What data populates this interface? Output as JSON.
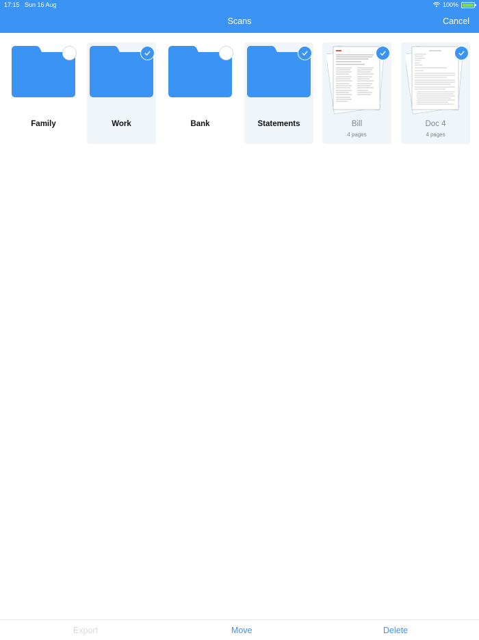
{
  "status_bar": {
    "time": "17:15",
    "date": "Sun 16 Aug",
    "battery": "100%"
  },
  "header": {
    "title": "Scans",
    "cancel_label": "Cancel"
  },
  "items": [
    {
      "kind": "folder",
      "label": "Family",
      "selected": false
    },
    {
      "kind": "folder",
      "label": "Work",
      "selected": true
    },
    {
      "kind": "folder",
      "label": "Bank",
      "selected": false
    },
    {
      "kind": "folder",
      "label": "Statements",
      "selected": true
    },
    {
      "kind": "document",
      "label": "Bill",
      "pages": "4 pages",
      "selected": true
    },
    {
      "kind": "document",
      "label": "Doc 4",
      "pages": "4 pages",
      "selected": true
    }
  ],
  "toolbar": {
    "export_label": "Export",
    "move_label": "Move",
    "delete_label": "Delete"
  },
  "colors": {
    "accent": "#3b93f3",
    "folder": "#3b93f3",
    "selected_bg": "#f0f5fa",
    "disabled_text": "#dcdcdc"
  }
}
